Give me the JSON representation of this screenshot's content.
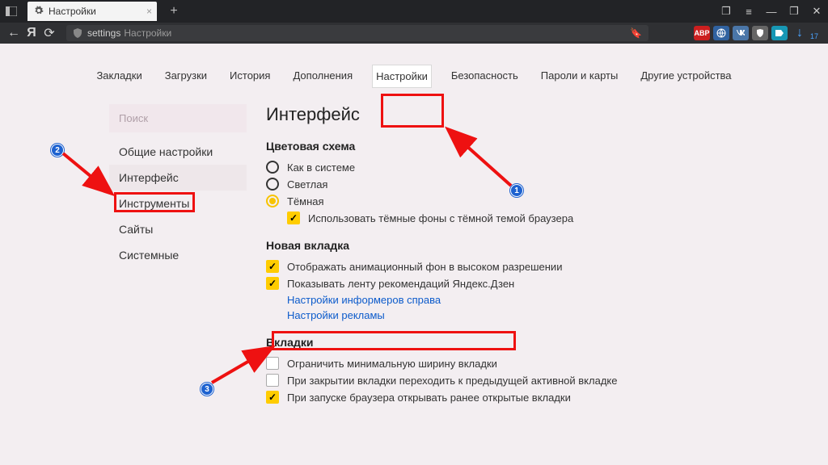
{
  "window": {
    "tab_title": "Настройки",
    "new_tab": "+",
    "btn_collection": "❐",
    "btn_menu": "≡",
    "btn_min": "—",
    "btn_max": "❐",
    "btn_close": "✕"
  },
  "addr": {
    "back": "←",
    "yalogo": "Я",
    "reload": "⟳",
    "field_prefix": "settings",
    "field_title": "Настройки",
    "star": "🔖",
    "dl_arrow": "↓",
    "dl_count": "17",
    "ext_abp": "ABP"
  },
  "topnav": {
    "bookmarks": "Закладки",
    "downloads": "Загрузки",
    "history": "История",
    "addons": "Дополнения",
    "settings": "Настройки",
    "security": "Безопасность",
    "passwords": "Пароли и карты",
    "devices": "Другие устройства"
  },
  "sidebar": {
    "search": "Поиск",
    "general": "Общие настройки",
    "interface": "Интерфейс",
    "tools": "Инструменты",
    "sites": "Сайты",
    "system": "Системные"
  },
  "main": {
    "h1": "Интерфейс",
    "scheme_h": "Цветовая схема",
    "scheme_sys": "Как в системе",
    "scheme_light": "Светлая",
    "scheme_dark": "Тёмная",
    "scheme_darkbg": "Использовать тёмные фоны с тёмной темой браузера",
    "newtab_h": "Новая вкладка",
    "newtab_anim": "Отображать анимационный фон в высоком разрешении",
    "newtab_zen": "Показывать ленту рекомендаций Яндекс.Дзен",
    "newtab_widgets": "Настройки информеров справа",
    "newtab_ads": "Настройки рекламы",
    "tabs_h": "Вкладки",
    "tabs_minw": "Ограничить минимальную ширину вкладки",
    "tabs_prev": "При закрытии вкладки переходить к предыдущей активной вкладке",
    "tabs_restore": "При запуске браузера открывать ранее открытые вкладки"
  },
  "anno": {
    "n1": "1",
    "n2": "2",
    "n3": "3"
  }
}
